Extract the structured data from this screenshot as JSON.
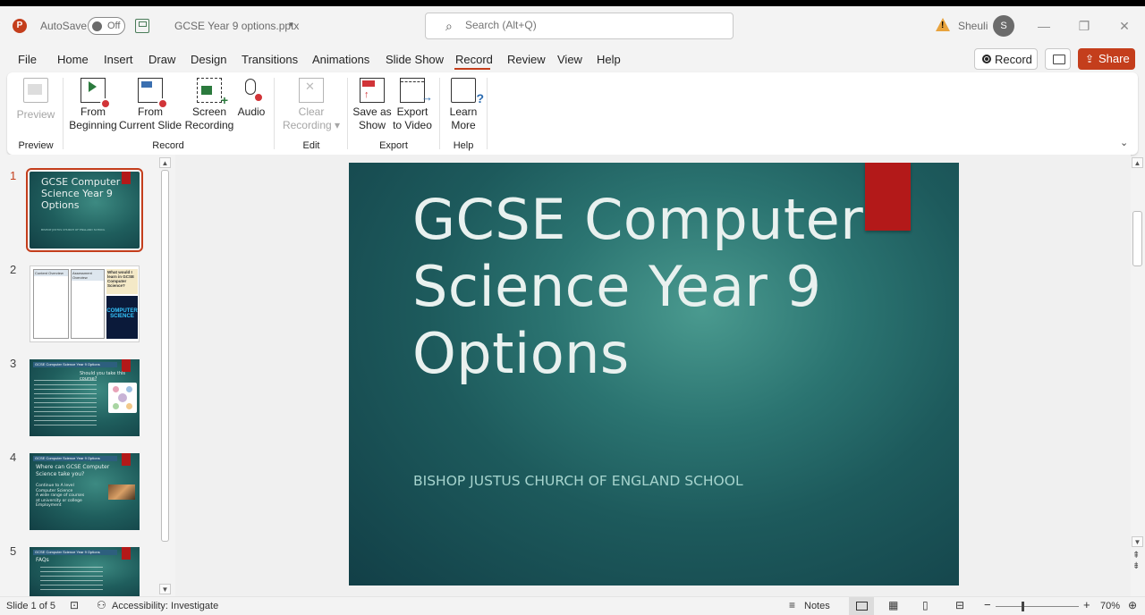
{
  "titlebar": {
    "app_icon": "P",
    "autosave_label": "AutoSave",
    "autosave_state": "Off",
    "doc_title": "GCSE Year 9 options.pptx",
    "doc_caret": "▾",
    "search_placeholder": "Search (Alt+Q)",
    "user_name": "Sheuli",
    "user_initial": "S",
    "win_min": "—",
    "win_restore": "❐",
    "win_close": "✕"
  },
  "tabs": {
    "file": "File",
    "home": "Home",
    "insert": "Insert",
    "draw": "Draw",
    "design": "Design",
    "transitions": "Transitions",
    "animations": "Animations",
    "slideshow": "Slide Show",
    "record": "Record",
    "review": "Review",
    "view": "View",
    "help": "Help"
  },
  "actions": {
    "record_label": "Record",
    "share_label": "Share"
  },
  "ribbon": {
    "preview": {
      "label": "Preview",
      "group": "Preview"
    },
    "from_beginning": {
      "line1": "From",
      "line2": "Beginning"
    },
    "from_current": {
      "line1": "From",
      "line2": "Current Slide"
    },
    "screen_recording": {
      "line1": "Screen",
      "line2": "Recording"
    },
    "audio": {
      "label": "Audio"
    },
    "record_group": "Record",
    "clear_recording": {
      "line1": "Clear",
      "line2": "Recording ▾"
    },
    "edit_group": "Edit",
    "save_as_show": {
      "line1": "Save as",
      "line2": "Show"
    },
    "export_video": {
      "line1": "Export",
      "line2": "to Video"
    },
    "export_group": "Export",
    "learn_more": {
      "line1": "Learn",
      "line2": "More"
    },
    "help_group": "Help"
  },
  "thumbnails": [
    {
      "num": "1",
      "title": "GCSE Computer Science Year 9 Options",
      "subtitle": "BISHOP JUSTUS CHURCH OF ENGLAND SCHOOL"
    },
    {
      "num": "2",
      "heading_left": "Content Overview",
      "heading_right": "Assessment Overview",
      "side_text": "What would I learn in GCSE Computer Science?",
      "badge": "COMPUTER SCIENCE"
    },
    {
      "num": "3",
      "bar": "GCSE Computer Science Year 9 Options",
      "heading": "Should you take this course?"
    },
    {
      "num": "4",
      "bar": "GCSE Computer Science Year 9 Options",
      "heading": "Where can GCSE Computer Science take you?",
      "items": [
        "Continue to A level Computer Science",
        "A wide range of courses at university or college",
        "Employment"
      ]
    },
    {
      "num": "5",
      "bar": "GCSE Computer Science Year 9 Options",
      "heading": "FAQs"
    }
  ],
  "slide": {
    "title": "GCSE Computer Science Year 9 Options",
    "subtitle": "BISHOP JUSTUS CHURCH OF ENGLAND SCHOOL"
  },
  "statusbar": {
    "slide_info": "Slide 1 of 5",
    "accessibility": "Accessibility: Investigate",
    "notes": "Notes",
    "zoom_minus": "−",
    "zoom_plus": "+",
    "zoom_level": "70%"
  }
}
